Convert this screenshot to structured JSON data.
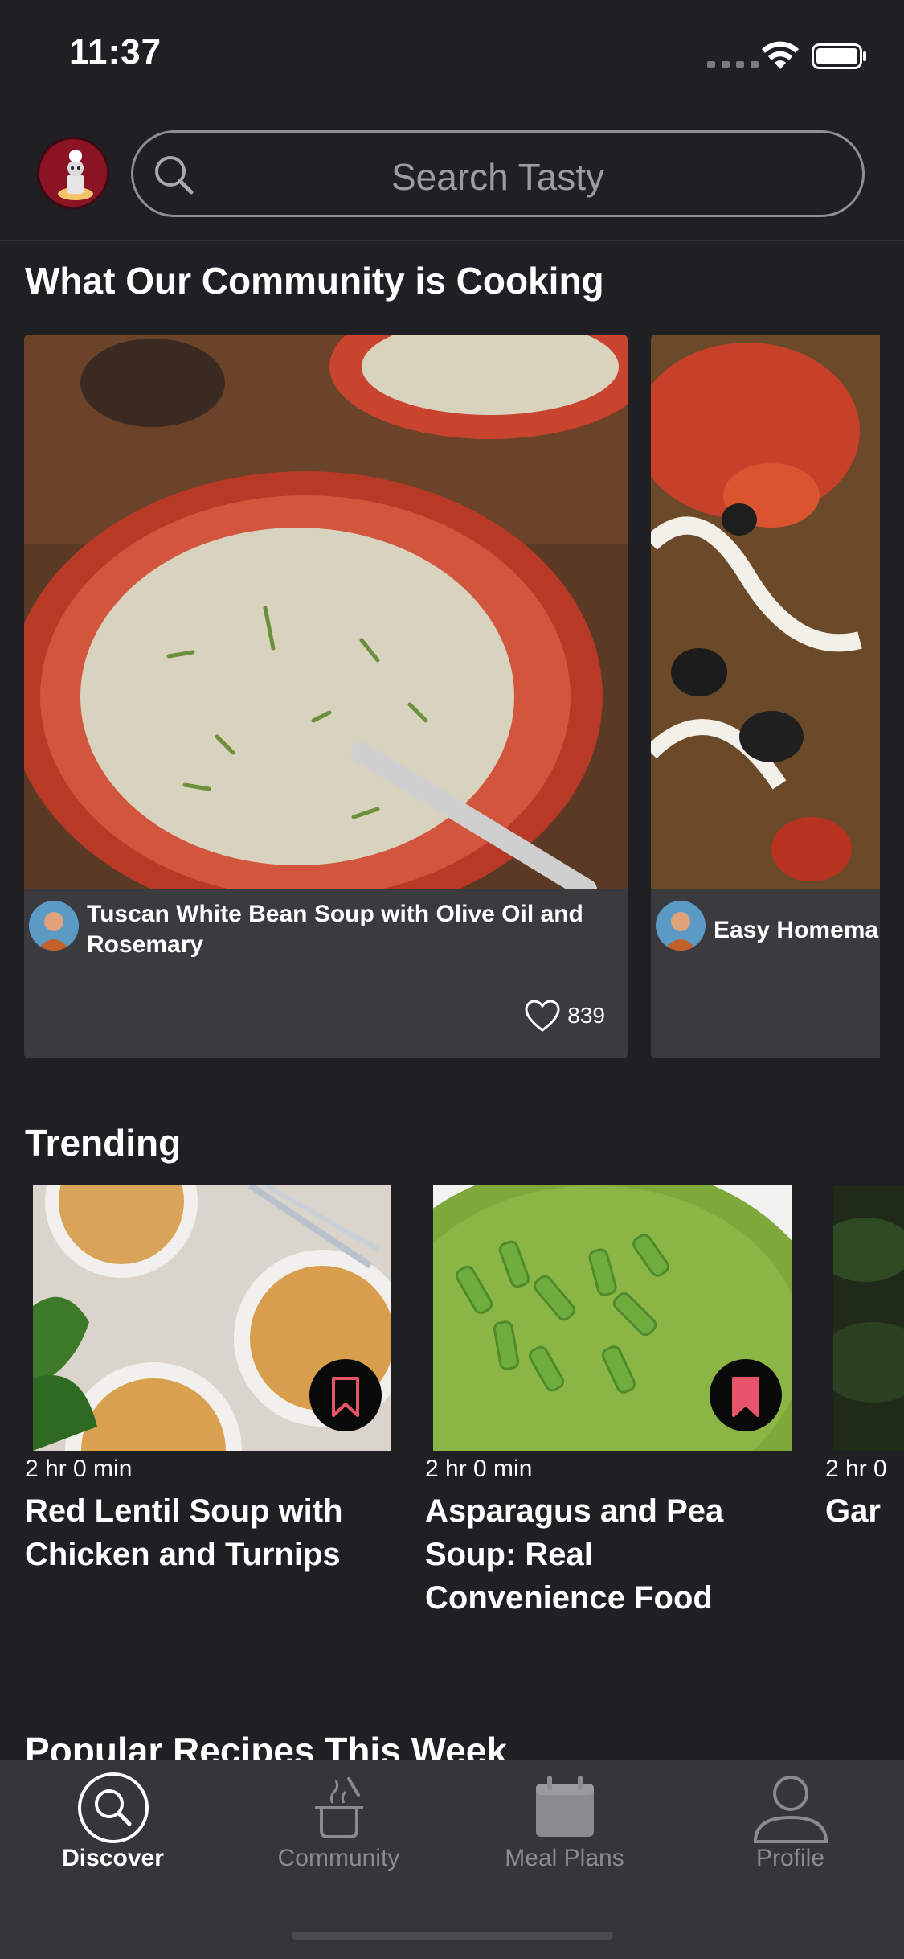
{
  "status_bar": {
    "time": "11:37"
  },
  "search": {
    "placeholder": "Search Tasty"
  },
  "community": {
    "title": "What Our Community is Cooking",
    "cards": [
      {
        "title": "Tuscan White Bean Soup with Olive Oil and Rosemary",
        "likes": "839"
      },
      {
        "title": "Easy Homema",
        "likes": ""
      }
    ]
  },
  "trending": {
    "title": "Trending",
    "cards": [
      {
        "time": "2 hr 0 min",
        "title": "Red Lentil Soup with Chicken and Turnips",
        "bookmarked": false
      },
      {
        "time": "2 hr 0 min",
        "title": "Asparagus and Pea Soup: Real Convenience Food",
        "bookmarked": true
      },
      {
        "time": "2 hr 0",
        "title": "Gar",
        "bookmarked": false
      }
    ]
  },
  "popular": {
    "title": "Popular Recipes This Week"
  },
  "tabs": [
    {
      "label": "Discover",
      "icon": "search-icon",
      "active": true
    },
    {
      "label": "Community",
      "icon": "pot-icon",
      "active": false
    },
    {
      "label": "Meal Plans",
      "icon": "calendar-icon",
      "active": false
    },
    {
      "label": "Profile",
      "icon": "person-icon",
      "active": false
    }
  ],
  "colors": {
    "accent": "#e8556a",
    "background": "#202024",
    "card": "#3a3a3f",
    "tab_bar": "#35353a"
  }
}
